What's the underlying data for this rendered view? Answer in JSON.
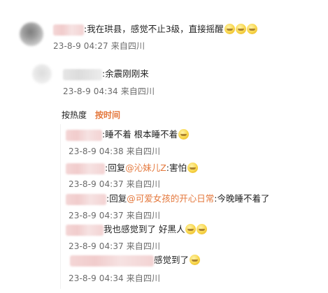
{
  "main_comment": {
    "text": ":我在珙县，感觉不止3级，直接摇醒",
    "meta": "23-8-9 04:27 来自四川"
  },
  "sub_comment": {
    "text": ":余震刚刚来",
    "meta": "23-8-9 04:34 来自四川"
  },
  "sort": {
    "hot_label": "按热度",
    "time_label": "按时间"
  },
  "replies": [
    {
      "pre": ":睡不着 根本睡不着",
      "meta": "23-8-9 04:38 来自四川"
    },
    {
      "pre": ":回复",
      "mention": "@沁妹儿Z",
      "post": ":害怕",
      "meta": "23-8-9 04:37 来自四川"
    },
    {
      "pre": ":回复",
      "mention": "@可爱女孩的开心日常",
      "post": ":今晚睡不着了",
      "meta": "23-8-9 04:37 来自四川"
    },
    {
      "pre": "我也感觉到了 好黑人",
      "meta": "23-8-9 04:37 来自四川"
    },
    {
      "pre": "感觉到了",
      "meta": "23-8-9 04:34 来自四川"
    }
  ],
  "icons": {
    "emoji": "crying-laughing-emoji-icon"
  }
}
